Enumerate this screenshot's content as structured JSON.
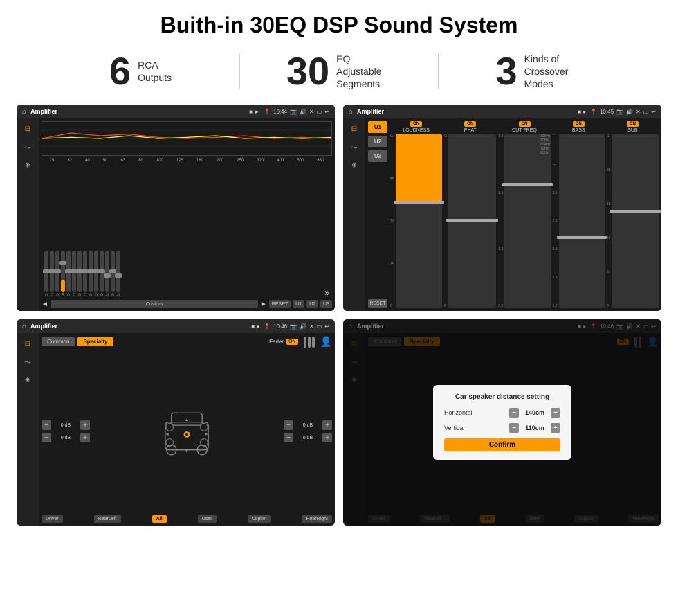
{
  "header": {
    "title": "Buith-in 30EQ DSP Sound System"
  },
  "stats": [
    {
      "number": "6",
      "label": "RCA\nOutputs"
    },
    {
      "number": "30",
      "label": "EQ Adjustable\nSegments"
    },
    {
      "number": "3",
      "label": "Kinds of\nCrossover Modes"
    }
  ],
  "screens": [
    {
      "id": "screen1",
      "statusBar": {
        "appTitle": "Amplifier",
        "time": "10:44"
      },
      "freqLabels": [
        "25",
        "32",
        "40",
        "50",
        "63",
        "80",
        "100",
        "125",
        "160",
        "200",
        "250",
        "320",
        "400",
        "500",
        "630"
      ],
      "sliderValues": [
        "0",
        "0",
        "0",
        "5",
        "0",
        "0",
        "0",
        "0",
        "0",
        "0",
        "0",
        "-1",
        "0",
        "-1"
      ],
      "controls": [
        "◄",
        "Custom",
        "►",
        "RESET",
        "U1",
        "U2",
        "U3"
      ]
    },
    {
      "id": "screen2",
      "statusBar": {
        "appTitle": "Amplifier",
        "time": "10:45"
      },
      "presets": [
        "U1",
        "U2",
        "U3"
      ],
      "channels": [
        {
          "name": "LOUDNESS",
          "on": true
        },
        {
          "name": "PHAT",
          "on": true
        },
        {
          "name": "CUT FREQ",
          "on": true
        },
        {
          "name": "BASS",
          "on": true
        },
        {
          "name": "SUB",
          "on": true
        }
      ],
      "resetLabel": "RESET"
    },
    {
      "id": "screen3",
      "statusBar": {
        "appTitle": "Amplifier",
        "time": "10:46"
      },
      "tabs": [
        "Common",
        "Specialty"
      ],
      "faderLabel": "Fader",
      "onLabel": "ON",
      "volControls": [
        {
          "label": "0 dB"
        },
        {
          "label": "0 dB"
        }
      ],
      "volControlsRight": [
        {
          "label": "0 dB"
        },
        {
          "label": "0 dB"
        }
      ],
      "bottomBtns": [
        "Driver",
        "RearLeft",
        "All",
        "User",
        "Copilot",
        "RearRight"
      ]
    },
    {
      "id": "screen4",
      "statusBar": {
        "appTitle": "Amplifier",
        "time": "10:46"
      },
      "tabs": [
        "Common",
        "Specialty"
      ],
      "dialog": {
        "title": "Car speaker distance setting",
        "rows": [
          {
            "label": "Horizontal",
            "value": "140cm"
          },
          {
            "label": "Vertical",
            "value": "110cm"
          }
        ],
        "confirmLabel": "Confirm"
      },
      "bottomBtns": [
        "Driver",
        "RearLeft",
        "All",
        "User",
        "Copilot",
        "RearRight"
      ]
    }
  ]
}
